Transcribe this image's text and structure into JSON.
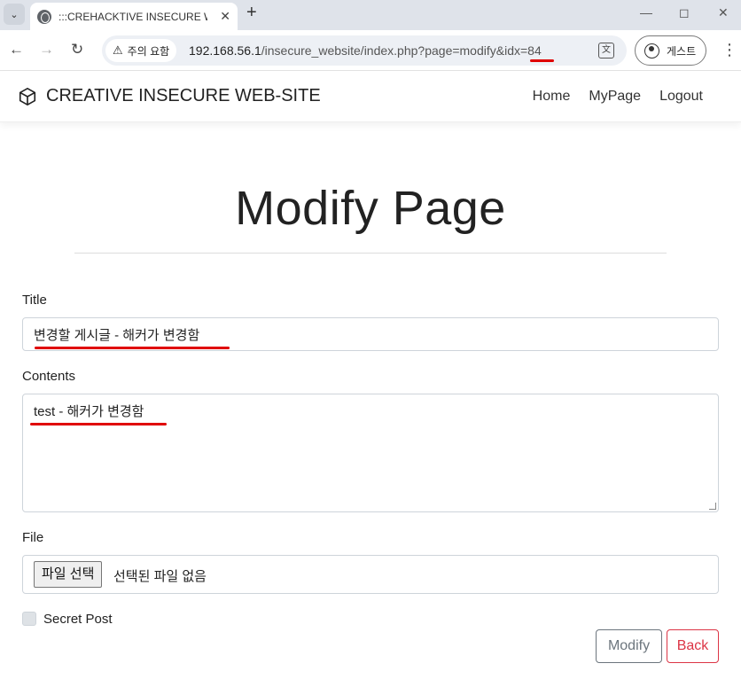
{
  "browser": {
    "tab_title": ":::CREHACKTIVE INSECURE WEB",
    "security_label": "주의 요함",
    "url_host": "192.168.56.1",
    "url_path": "/insecure_website/index.php?page=modify&idx=84",
    "profile_label": "게스트"
  },
  "site": {
    "brand": "CREATIVE INSECURE WEB-SITE",
    "nav": [
      "Home",
      "MyPage",
      "Logout"
    ]
  },
  "page": {
    "heading": "Modify Page",
    "title_label": "Title",
    "title_value": "변경할 게시글 - 해커가 변경함",
    "contents_label": "Contents",
    "contents_value": "test - 해커가 변경함",
    "file_label": "File",
    "file_button": "파일 선택",
    "file_status": "선택된 파일 없음",
    "secret_label": "Secret Post",
    "secret_checked": false,
    "modify_button": "Modify",
    "back_button": "Back"
  },
  "annotation_color": "#e00000"
}
